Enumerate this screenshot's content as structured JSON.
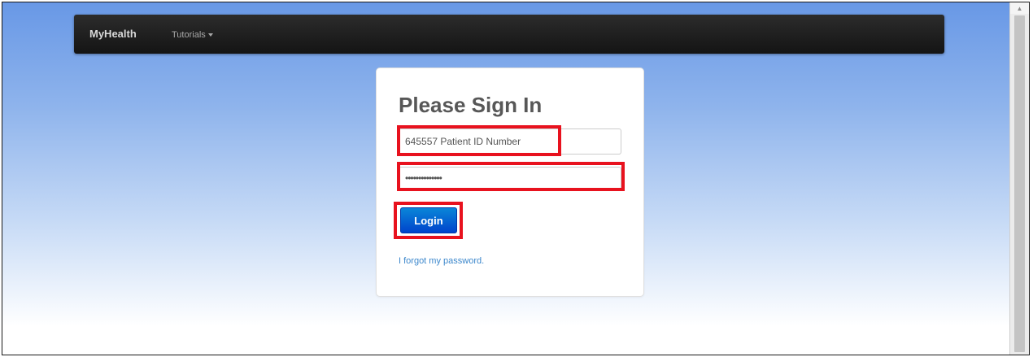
{
  "navbar": {
    "brand": "MyHealth",
    "menu_label": "Tutorials"
  },
  "login": {
    "heading": "Please Sign In",
    "username_value": "645557 Patient ID Number",
    "password_value": "••••••••••••••",
    "submit_label": "Login",
    "forgot_link": "I forgot my password."
  },
  "colors": {
    "navbar_bg": "#1f1f1f",
    "button_blue": "#0a6fd4",
    "link_blue": "#3b87cc",
    "highlight_red": "#e8121e",
    "background_top": "#6898e6"
  },
  "icons": {
    "dropdown": "caret-down-icon",
    "scrollbar_arrow": "scroll-up-arrow-icon"
  }
}
